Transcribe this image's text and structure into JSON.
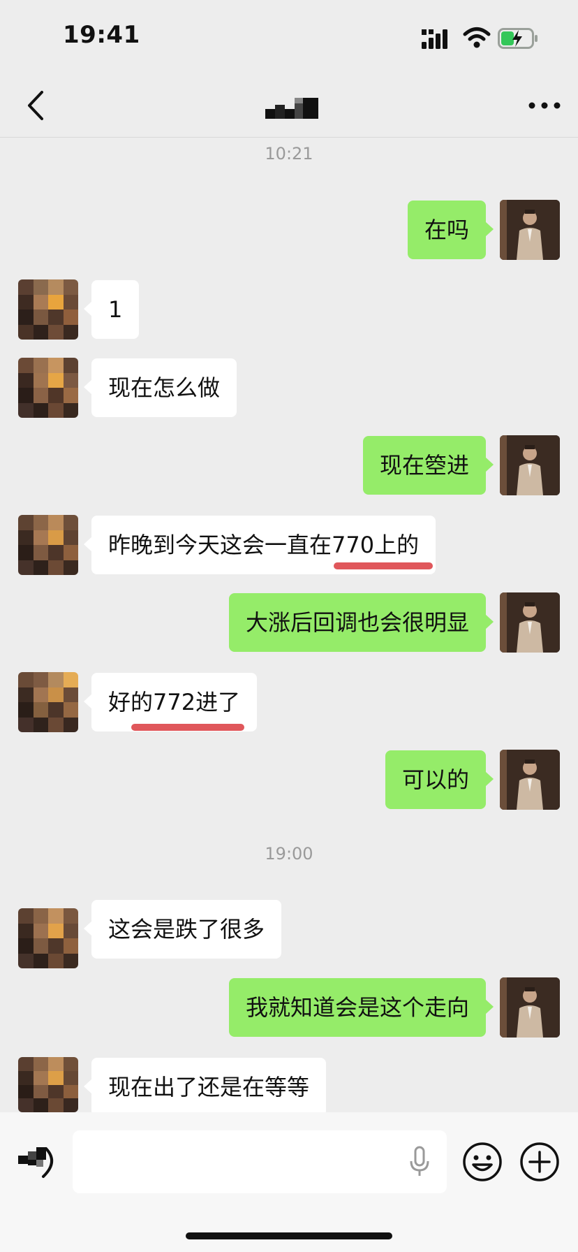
{
  "status_bar": {
    "time": "19:41"
  },
  "header": {
    "back_icon": "chevron-left-icon",
    "title": "",
    "more_icon": "more-horizontal-icon"
  },
  "chat": {
    "timestamps": [
      "10:21",
      "19:00"
    ],
    "messages": [
      {
        "side": "out",
        "text": "在吗"
      },
      {
        "side": "in",
        "text": "1"
      },
      {
        "side": "in",
        "text": "现在怎么做"
      },
      {
        "side": "out",
        "text": "现在箜进"
      },
      {
        "side": "in",
        "text": "昨晚到今天这会一直在770上的"
      },
      {
        "side": "out",
        "text": "大涨后回调也会很明显"
      },
      {
        "side": "in",
        "text": "好的772进了"
      },
      {
        "side": "out",
        "text": "可以的"
      },
      {
        "side": "in",
        "text": "这会是跌了很多"
      },
      {
        "side": "out",
        "text": "我就知道会是这个走向"
      },
      {
        "side": "in",
        "text": "现在出了还是在等等"
      }
    ]
  },
  "composer": {
    "input_value": "",
    "voice_icon": "voice-mode-icon",
    "mic_icon": "microphone-icon",
    "emoji_icon": "emoji-icon",
    "plus_icon": "plus-circle-icon"
  },
  "colors": {
    "outgoing_bubble": "#95ec69",
    "incoming_bubble": "#ffffff",
    "background": "#ededed",
    "highlight_underline": "#e0575b"
  }
}
